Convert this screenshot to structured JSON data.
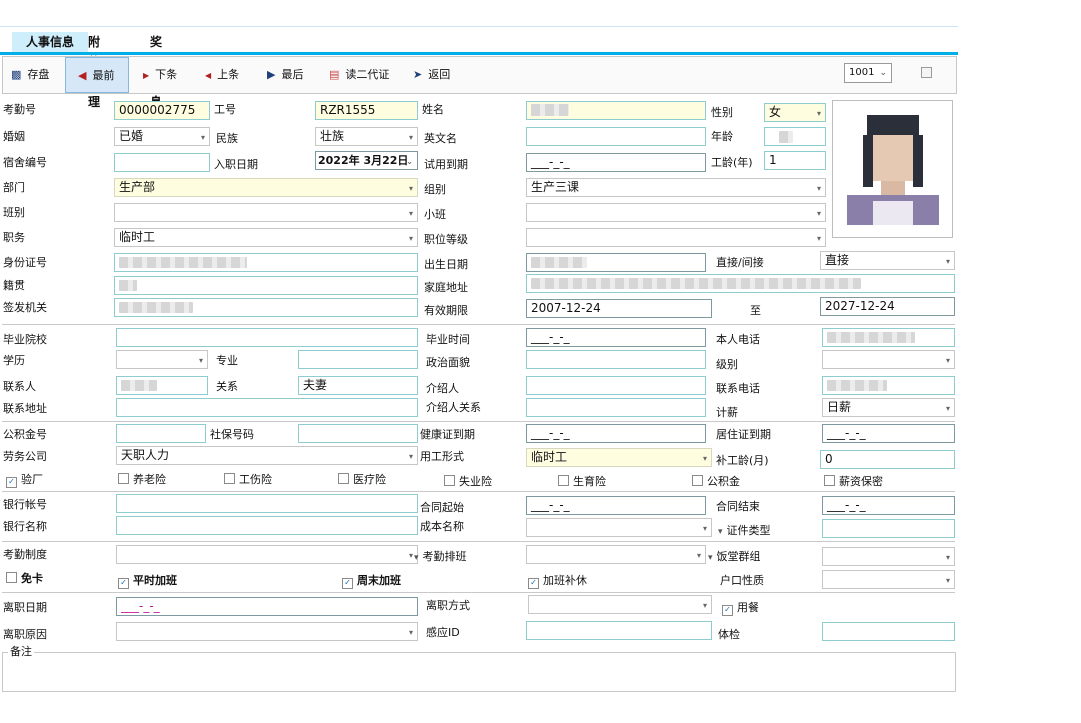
{
  "tabs": [
    {
      "label": "人事信息",
      "active": true
    },
    {
      "label": "附件管理",
      "active": false
    },
    {
      "label": "奖罚信息",
      "active": false
    }
  ],
  "toolbar": {
    "save": "存盘",
    "first": "最前",
    "next": "下条",
    "prev": "上条",
    "last": "最后",
    "read_id": "读二代证",
    "back": "返回",
    "select_value": "1001"
  },
  "labels": {
    "attendance_no": "考勤号",
    "work_no": "工号",
    "name": "姓名",
    "gender": "性别",
    "marriage": "婚姻",
    "ethnicity": "民族",
    "english_name": "英文名",
    "age": "年龄",
    "dorm_no": "宿舍编号",
    "hire_date": "入职日期",
    "probation_end": "试用到期",
    "seniority": "工龄(年)",
    "department": "部门",
    "group": "组别",
    "shift": "班别",
    "sub_shift": "小班",
    "position": "职务",
    "position_level": "职位等级",
    "id_card": "身份证号",
    "birth_date": "出生日期",
    "direct_indirect": "直接/间接",
    "native_place": "籍贯",
    "home_address": "家庭地址",
    "issuing_authority": "签发机关",
    "valid_period": "有效期限",
    "to": "至",
    "school": "毕业院校",
    "grad_time": "毕业时间",
    "phone": "本人电话",
    "education": "学历",
    "major": "专业",
    "political": "政治面貌",
    "level": "级别",
    "contact": "联系人",
    "relation": "关系",
    "introducer": "介绍人",
    "contact_phone": "联系电话",
    "contact_address": "联系地址",
    "introducer_relation": "介绍人关系",
    "pay_type": "计薪",
    "fund_no": "公积金号",
    "social_no": "社保号码",
    "health_cert": "健康证到期",
    "residence_permit": "居住证到期",
    "labor_company": "劳务公司",
    "employment_form": "用工形式",
    "makeup_seniority": "补工龄(月)",
    "bank_account": "银行帐号",
    "contract_start": "合同起始",
    "contract_end": "合同结束",
    "bank_name": "银行名称",
    "cost_name": "成本名称",
    "cert_type": "证件类型",
    "attendance_system": "考勤制度",
    "attendance_schedule": "考勤排班",
    "canteen_group": "饭堂群组",
    "hukou": "户口性质",
    "leave_date": "离职日期",
    "leave_method": "离职方式",
    "leave_reason": "离职原因",
    "sensor_id": "感应ID",
    "checkup": "体检",
    "remark": "备注"
  },
  "values": {
    "attendance_no": "0000002775",
    "work_no": "RZR1555",
    "gender": "女",
    "marriage": "已婚",
    "ethnicity": "壮族",
    "hire_date": "2022年  3月22日",
    "probation_end": "___-_-_",
    "seniority": "1",
    "department": "生产部",
    "group": "生产三课",
    "position": "临时工",
    "direct_indirect": "直接",
    "valid_from": "2007-12-24",
    "valid_to": "2027-12-24",
    "grad_time": "___-_-_",
    "relation": "夫妻",
    "pay_type": "日薪",
    "health_cert": "___-_-_",
    "residence_permit": "___-_-_",
    "labor_company": "天职人力",
    "employment_form": "临时工",
    "makeup_seniority": "0",
    "contract_start": "___-_-_",
    "contract_end": "___-_-_",
    "leave_date": "___-_-_"
  },
  "checkboxes": {
    "factory_check": {
      "label": "验厂",
      "checked": true
    },
    "pension": {
      "label": "养老险",
      "checked": false
    },
    "injury": {
      "label": "工伤险",
      "checked": false
    },
    "medical": {
      "label": "医疗险",
      "checked": false
    },
    "unemployment": {
      "label": "失业险",
      "checked": false
    },
    "maternity": {
      "label": "生育险",
      "checked": false
    },
    "housing_fund": {
      "label": "公积金",
      "checked": false
    },
    "salary_secret": {
      "label": "薪资保密",
      "checked": false
    },
    "no_punch": {
      "label": "免卡",
      "checked": false
    },
    "weekday_ot": {
      "label": "平时加班",
      "checked": true
    },
    "weekend_ot": {
      "label": "周末加班",
      "checked": true
    },
    "ot_comp": {
      "label": "加班补休",
      "checked": true
    },
    "meal": {
      "label": "用餐",
      "checked": true
    }
  }
}
